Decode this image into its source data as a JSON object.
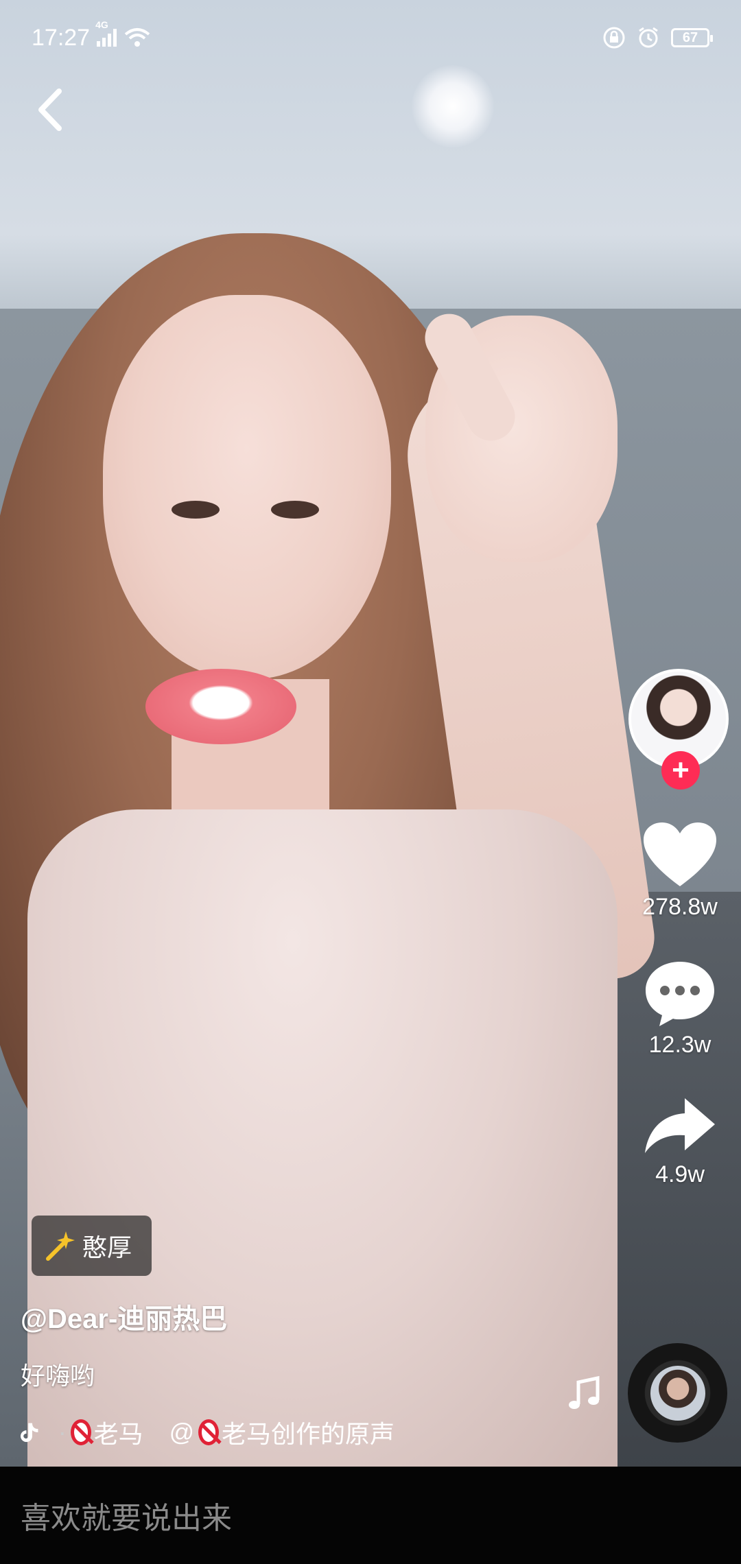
{
  "status_bar": {
    "time": "17:27",
    "network": "4G",
    "battery": "67"
  },
  "video": {
    "effect_label": "憨厚",
    "author": "@Dear-迪丽热巴",
    "description": "好嗨哟",
    "music_part1": "老马",
    "music_part2": "@",
    "music_part3": "老马创作的原声"
  },
  "actions": {
    "likes": "278.8w",
    "comments": "12.3w",
    "shares": "4.9w",
    "follow_symbol": "+"
  },
  "comment_bar": {
    "placeholder": "喜欢就要说出来"
  },
  "icons": [
    "back-arrow-icon",
    "signal-icon",
    "wifi-icon",
    "lock-icon",
    "alarm-icon",
    "battery-icon",
    "heart-icon",
    "comment-icon",
    "share-icon",
    "tiktok-icon",
    "music-note-icon",
    "sparkle-wand-icon",
    "no-entry-icon"
  ],
  "colors": {
    "follow_accent": "#fe2c55",
    "no_entry": "#e02236",
    "effect_star": "#f6c32a"
  }
}
